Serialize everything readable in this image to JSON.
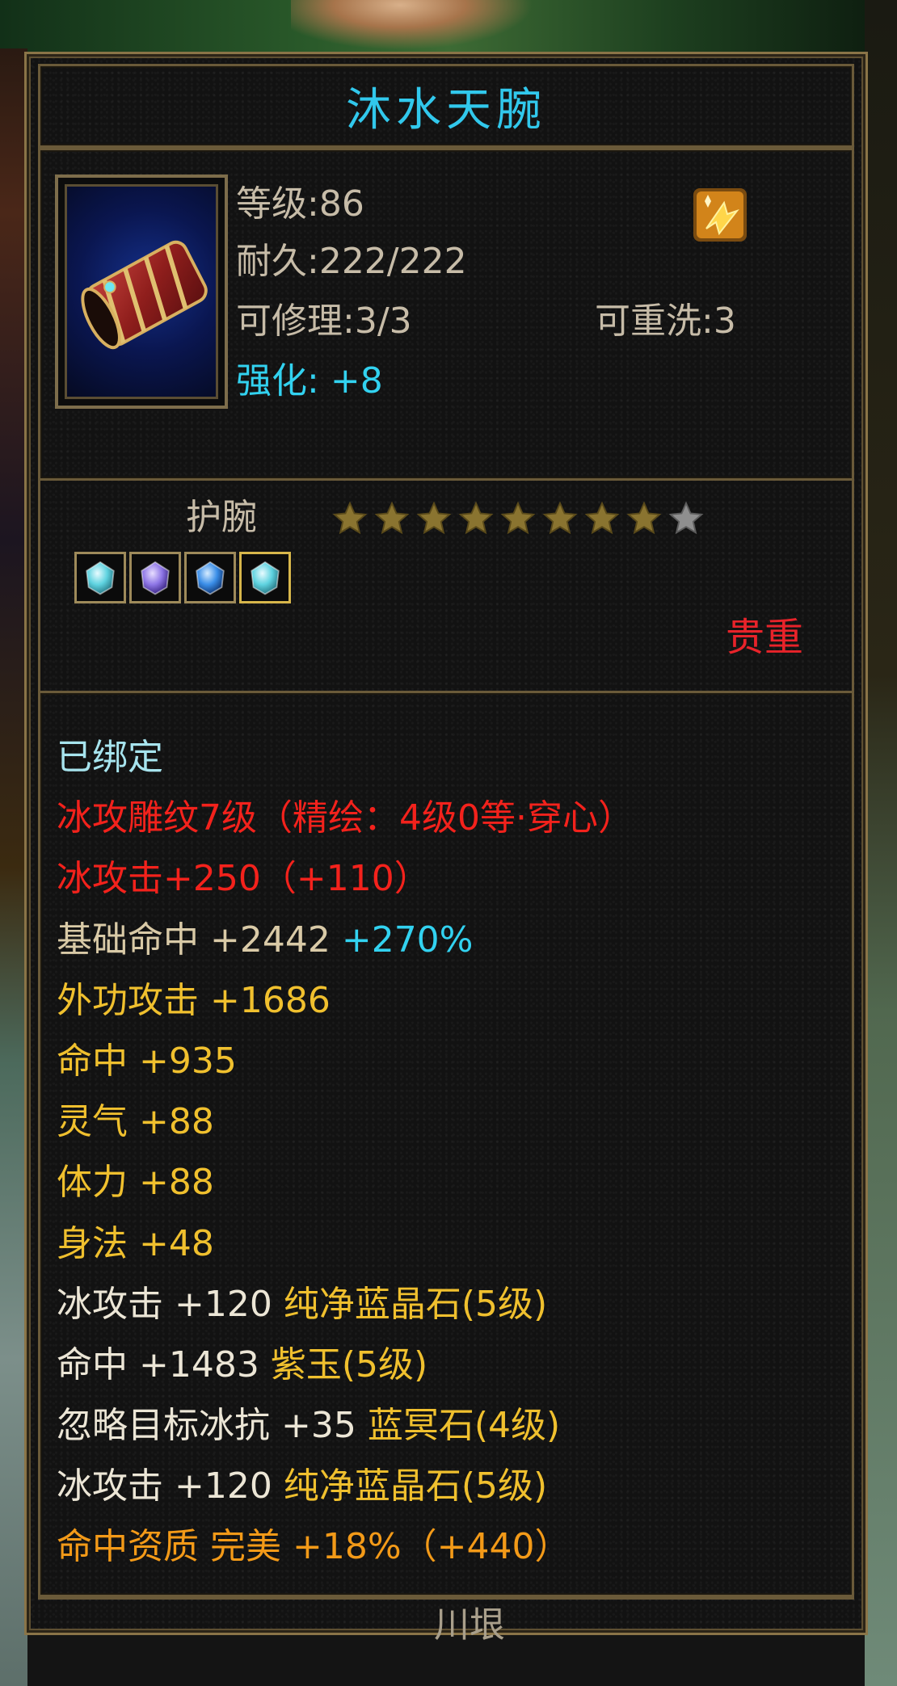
{
  "item": {
    "name": "沐水天腕",
    "type": "护腕",
    "quality": "贵重",
    "level": "等级:86",
    "durability": "耐久:222/222",
    "repairable": "可修理:3/3",
    "rewashable": "可重洗:3",
    "enhance_label": "强化:",
    "enhance_value": "+8",
    "stars_filled": 8,
    "stars_total": 9,
    "gems": [
      "cyan-gem-icon",
      "purple-gem-icon",
      "blue-gem-icon",
      "cyan-gem-icon"
    ]
  },
  "attributes": [
    {
      "segments": [
        {
          "text": "已绑定",
          "color": "lightcyan"
        }
      ]
    },
    {
      "segments": [
        {
          "text": "冰攻雕纹7级（精绘：4级0等·穿心）",
          "color": "red"
        }
      ]
    },
    {
      "segments": [
        {
          "text": "冰攻击+250（+110）",
          "color": "red"
        }
      ]
    },
    {
      "segments": [
        {
          "text": "基础命中 +2442 ",
          "color": "beige"
        },
        {
          "text": "+270%",
          "color": "cyan"
        }
      ]
    },
    {
      "segments": [
        {
          "text": "外功攻击 +1686",
          "color": "yellow"
        }
      ]
    },
    {
      "segments": [
        {
          "text": "命中 +935",
          "color": "yellow"
        }
      ]
    },
    {
      "segments": [
        {
          "text": "灵气 +88",
          "color": "yellow"
        }
      ]
    },
    {
      "segments": [
        {
          "text": "体力 +88",
          "color": "yellow"
        }
      ]
    },
    {
      "segments": [
        {
          "text": "身法 +48",
          "color": "yellow"
        }
      ]
    },
    {
      "segments": [
        {
          "text": "冰攻击 +120 ",
          "color": "white"
        },
        {
          "text": "纯净蓝晶石(5级)",
          "color": "yellow"
        }
      ]
    },
    {
      "segments": [
        {
          "text": "命中 +1483 ",
          "color": "white"
        },
        {
          "text": "紫玉(5级)",
          "color": "yellow"
        }
      ]
    },
    {
      "segments": [
        {
          "text": "忽略目标冰抗 +35 ",
          "color": "white"
        },
        {
          "text": "蓝冥石(4级)",
          "color": "yellow"
        }
      ]
    },
    {
      "segments": [
        {
          "text": "冰攻击 +120 ",
          "color": "white"
        },
        {
          "text": "纯净蓝晶石(5级)",
          "color": "yellow"
        }
      ]
    },
    {
      "segments": [
        {
          "text": "命中资质  完美 +18%（+440）",
          "color": "orange"
        }
      ]
    }
  ],
  "footer": "川垠",
  "colors": {
    "title": "#31c8ec",
    "border": "#6a5a39",
    "precious": "#e8232a"
  }
}
